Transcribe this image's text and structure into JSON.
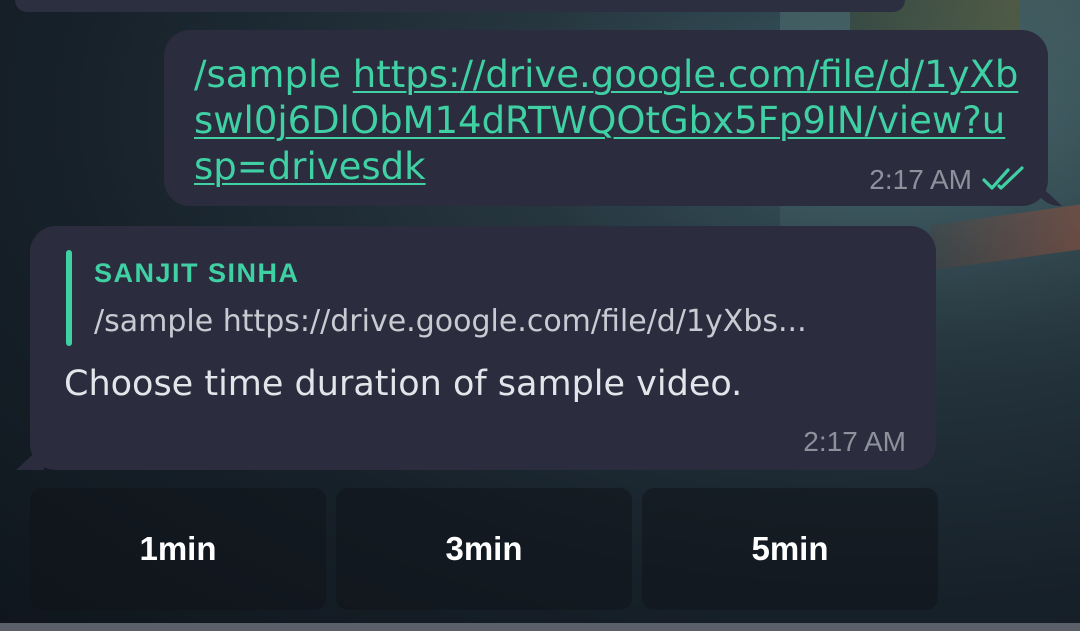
{
  "outgoing_message": {
    "command": "/sample",
    "link": "https://drive.google.com/file/d/1yXbswl0j6DlObM14dRTWQOtGbx5Fp9IN/view?usp=drivesdk",
    "time": "2:17 AM",
    "status_icon": "double-check-icon"
  },
  "incoming_message": {
    "reply_to_name": "SANJIT SINHA",
    "reply_to_text": "/sample https://drive.google.com/file/d/1yXbs...",
    "text": "Choose time duration of sample video.",
    "time": "2:17 AM"
  },
  "keyboard": {
    "buttons": [
      {
        "label": "1min"
      },
      {
        "label": "3min"
      },
      {
        "label": "5min"
      }
    ]
  },
  "colors": {
    "accent": "#3fd0a4",
    "bubble": "#2b2d3e",
    "time_text": "#8e919c"
  }
}
